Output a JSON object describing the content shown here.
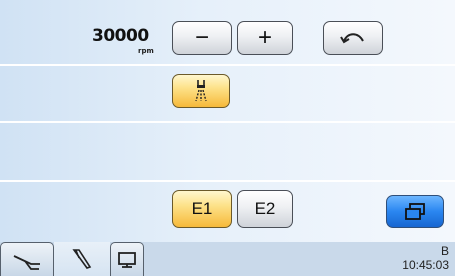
{
  "speed": {
    "value": "30000",
    "unit": "rpm"
  },
  "buttons": {
    "decrease": "−",
    "increase": "+",
    "e1": "E1",
    "e2": "E2"
  },
  "icons": {
    "undo": "undo-icon",
    "spray": "spray-icon",
    "window": "window-icon",
    "chair": "chair-icon",
    "instrument": "instrument-icon",
    "monitor": "monitor-icon"
  },
  "status": {
    "mode": "B",
    "time": "10:45:03"
  },
  "colors": {
    "accent_yellow": "#f6b93a",
    "accent_blue": "#2a86f0",
    "background": "#d0e2f4"
  }
}
